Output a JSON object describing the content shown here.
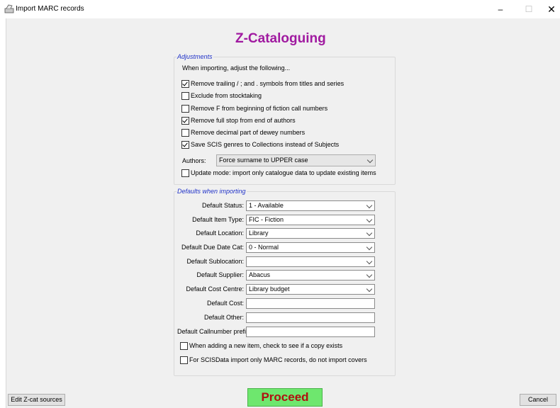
{
  "window": {
    "title": "Import MARC records",
    "minimize": "–",
    "maximize": "☐",
    "close": "✕"
  },
  "heading": "Z-Cataloguing",
  "adjustments": {
    "legend": "Adjustments",
    "intro": "When importing, adjust the following...",
    "options": [
      {
        "label": "Remove trailing / ; and . symbols from titles and series",
        "checked": true
      },
      {
        "label": "Exclude from stocktaking",
        "checked": false
      },
      {
        "label": "Remove F from beginning of fiction call numbers",
        "checked": false
      },
      {
        "label": "Remove full stop from end of authors",
        "checked": true
      },
      {
        "label": "Remove decimal part of dewey numbers",
        "checked": false
      },
      {
        "label": "Save SCIS genres to Collections instead of Subjects",
        "checked": true
      }
    ],
    "authors_label": "Authors:",
    "authors_value": "Force surname to UPPER case",
    "update_mode": {
      "label": "Update mode: import only catalogue data to update existing items",
      "checked": false
    }
  },
  "defaults": {
    "legend": "Defaults when importing",
    "fields": [
      {
        "label": "Default Status:",
        "value": "1 - Available",
        "kind": "select"
      },
      {
        "label": "Default Item Type:",
        "value": "FIC - Fiction",
        "kind": "select"
      },
      {
        "label": "Default Location:",
        "value": "Library",
        "kind": "select"
      },
      {
        "label": "Default Due Date Cat:",
        "value": "0 - Normal",
        "kind": "select"
      },
      {
        "label": "Default Sublocation:",
        "value": "",
        "kind": "select"
      },
      {
        "label": "Default Supplier:",
        "value": "Abacus",
        "kind": "select"
      },
      {
        "label": "Default Cost Centre:",
        "value": "Library budget",
        "kind": "select"
      },
      {
        "label": "Default Cost:",
        "value": "",
        "kind": "text"
      },
      {
        "label": "Default Other:",
        "value": "",
        "kind": "text"
      },
      {
        "label": "Default Callnumber prefix:",
        "value": "",
        "kind": "text"
      }
    ],
    "check_copy": {
      "label": "When adding a new item, check to see if a copy exists",
      "checked": false
    },
    "scis_only": {
      "label": "For SCISData import only MARC records, do not import covers",
      "checked": false
    }
  },
  "buttons": {
    "edit_sources": "Edit Z-cat sources",
    "proceed": "Proceed",
    "cancel": "Cancel"
  },
  "colors": {
    "heading": "#a01aa0",
    "legend": "#2032c8",
    "proceed_bg": "#6ee76e",
    "proceed_text": "#b01010"
  }
}
